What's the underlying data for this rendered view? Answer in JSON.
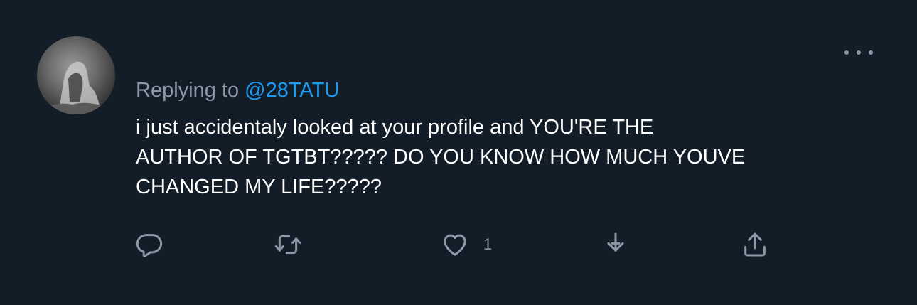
{
  "reply": {
    "prefix": "Replying to ",
    "handle": "@28TATU"
  },
  "tweet": {
    "lines": [
      "i just accidentaly looked at your profile and YOU'RE THE",
      "AUTHOR OF TGTBT????? DO YOU KNOW HOW MUCH YOUVE",
      "CHANGED MY LIFE?????"
    ]
  },
  "actions": {
    "like_count": "1"
  },
  "colors": {
    "background": "#131d28",
    "text": "#ffffff",
    "muted": "#8b98a5",
    "accent": "#1d9bf0"
  },
  "icons": [
    "reply-icon",
    "retweet-icon",
    "heart-icon",
    "bookmark-download-icon",
    "share-icon",
    "more-icon"
  ]
}
